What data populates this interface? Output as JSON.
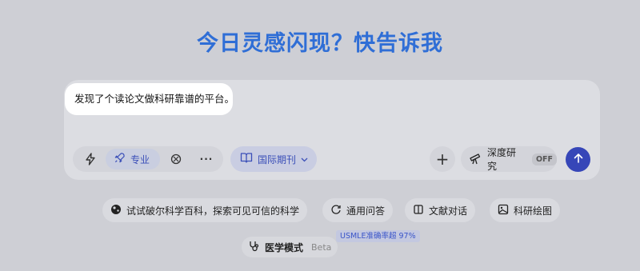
{
  "headline": "今日灵感闪现？快告诉我",
  "composer": {
    "prompt_text": "发现了个读论文做科研靠谱的平台。"
  },
  "toolbar": {
    "zhuanye_label": "专业",
    "more_label": "···",
    "journal_label": "国际期刊",
    "plus_label": "+",
    "deep_research_label": "深度研究",
    "deep_research_state": "OFF"
  },
  "suggestions": [
    {
      "label": "试试破尔科学百科，探索可见可信的科学",
      "icon": "science-icon"
    },
    {
      "label": "通用问答",
      "icon": "chat-icon"
    },
    {
      "label": "文献对话",
      "icon": "document-icon"
    },
    {
      "label": "科研绘图",
      "icon": "image-icon"
    }
  ],
  "medical": {
    "label": "医学模式",
    "badge": "Beta",
    "usmle_note": "USMLE准确率超 97%"
  },
  "colors": {
    "accent": "#3646b8",
    "headline": "#2f6ed6",
    "background": "#cecfd5"
  }
}
